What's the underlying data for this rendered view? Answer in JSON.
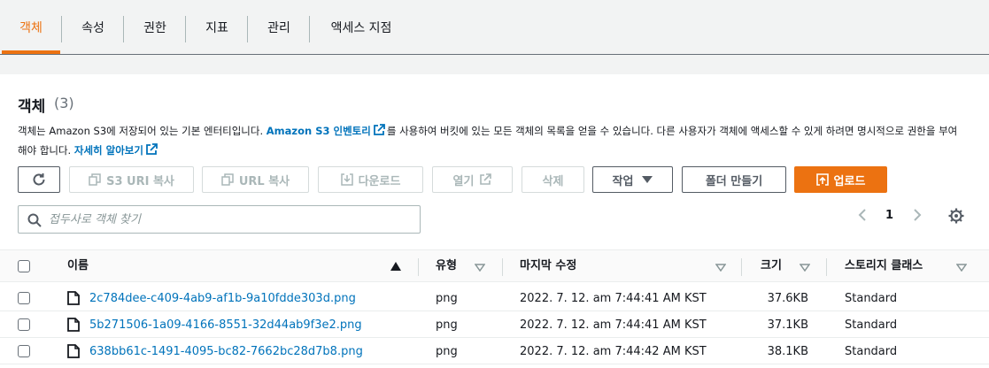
{
  "tabs": [
    {
      "label": "객체",
      "active": true
    },
    {
      "label": "속성"
    },
    {
      "label": "권한"
    },
    {
      "label": "지표"
    },
    {
      "label": "관리"
    },
    {
      "label": "액세스 지점"
    }
  ],
  "panel": {
    "title": "객체",
    "count": "(3)",
    "description": {
      "part1": "객체는 Amazon S3에 저장되어 있는 기본 엔터티입니다. ",
      "link1": "Amazon S3 인벤토리",
      "part2": "를 사용하여 버킷에 있는 모든 객체의 목록을 얻을 수 있습니다. 다른 사용자가 객체에 액세스할 수 있게 하려면 명시적으로 권한을 부여해야 합니다. ",
      "link2": "자세히 알아보기"
    }
  },
  "toolbar": {
    "copy_s3_uri": "S3 URI 복사",
    "copy_url": "URL 복사",
    "download": "다운로드",
    "open": "열기",
    "delete": "삭제",
    "actions": "작업",
    "create_folder": "폴더 만들기",
    "upload": "업로드"
  },
  "search": {
    "placeholder": "접두사로 객체 찾기"
  },
  "pagination": {
    "current_page": "1"
  },
  "table": {
    "columns": [
      "이름",
      "유형",
      "마지막 수정",
      "크기",
      "스토리지 클래스"
    ],
    "rows": [
      {
        "name": "2c784dee-c409-4ab9-af1b-9a10fdde303d.png",
        "type": "png",
        "modified": "2022. 7. 12. am 7:44:41 AM KST",
        "size": "37.6KB",
        "storage": "Standard"
      },
      {
        "name": "5b271506-1a09-4166-8551-32d44ab9f3e2.png",
        "type": "png",
        "modified": "2022. 7. 12. am 7:44:41 AM KST",
        "size": "37.1KB",
        "storage": "Standard"
      },
      {
        "name": "638bb61c-1491-4095-bc82-7662bc28d7b8.png",
        "type": "png",
        "modified": "2022. 7. 12. am 7:44:42 AM KST",
        "size": "38.1KB",
        "storage": "Standard"
      }
    ]
  },
  "colors": {
    "accent": "#ec7211",
    "link": "#0073bb",
    "text": "#16191f",
    "muted": "#687078"
  },
  "icons": [
    "refresh-icon",
    "copy-icon",
    "download-icon",
    "external-link-icon",
    "caret-down-icon",
    "upload-icon",
    "search-icon",
    "chevron-left-icon",
    "chevron-right-icon",
    "gear-icon",
    "sort-ascending-icon",
    "sort-caret-icon",
    "file-icon"
  ]
}
